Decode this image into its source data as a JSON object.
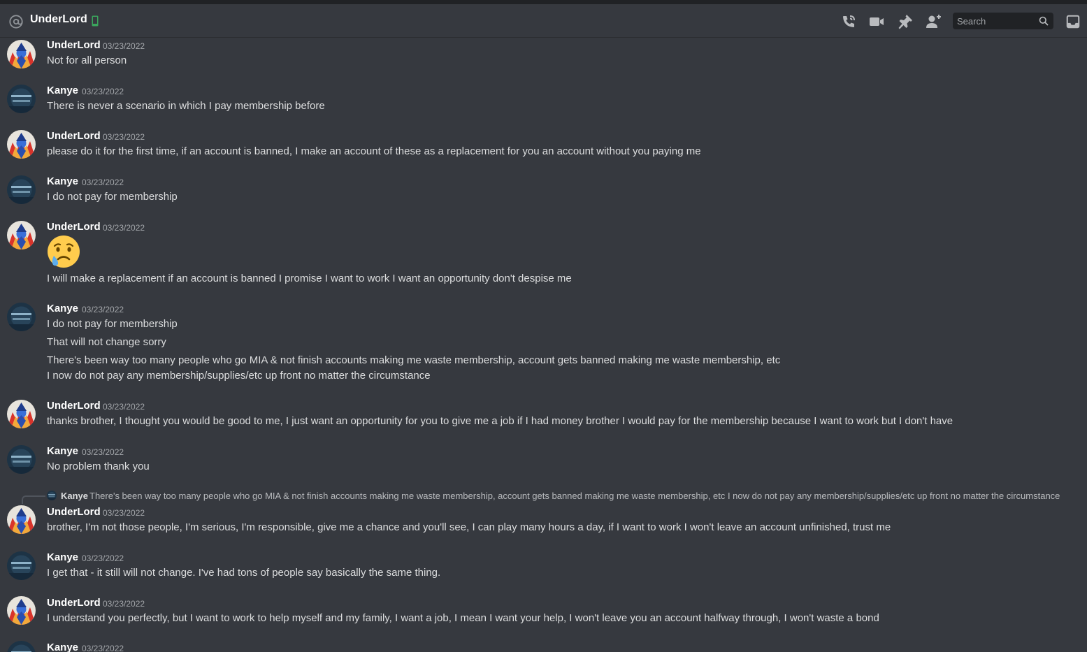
{
  "header": {
    "channel_name": "UnderLord",
    "search_placeholder": "Search"
  },
  "icons": {
    "at": "at-sign-icon",
    "mobile": "mobile-phone-icon",
    "call": "phone-call-icon",
    "video": "video-camera-icon",
    "pin": "pin-icon",
    "add_friend": "add-friend-icon",
    "search": "search-icon",
    "inbox": "inbox-icon"
  },
  "colors": {
    "background": "#36393f",
    "header_text": "#ffffff",
    "mobile_status": "#3ba55c",
    "search_bg": "#202225"
  },
  "messages": [
    {
      "author": "UnderLord",
      "timestamp": "03/23/2022",
      "lines": [
        "Not for all person"
      ]
    },
    {
      "author": "Kanye",
      "timestamp": "03/23/2022",
      "lines": [
        "There is never a scenario in which I pay membership before"
      ]
    },
    {
      "author": "UnderLord",
      "timestamp": "03/23/2022",
      "lines": [
        "please do it for the first time, if an account is banned, I make an account of these as a replacement for you an account without you paying me"
      ]
    },
    {
      "author": "Kanye",
      "timestamp": "03/23/2022",
      "lines": [
        "I do not pay for membership"
      ]
    },
    {
      "author": "UnderLord",
      "timestamp": "03/23/2022",
      "emoji": "crying-face-emoji",
      "lines": [
        "I will make a replacement if an account is banned I promise I want to work I want an opportunity don't despise me"
      ]
    },
    {
      "author": "Kanye",
      "timestamp": "03/23/2022",
      "lines": [
        "I do not pay for membership",
        "That will not change sorry",
        "There's been way too many people who go MIA & not finish accounts making me waste membership, account gets banned making me waste membership, etc",
        "I now do not pay any membership/supplies/etc up front no matter the circumstance"
      ]
    },
    {
      "author": "UnderLord",
      "timestamp": "03/23/2022",
      "lines": [
        "thanks brother, I thought you would be good to me, I just want an opportunity for you to give me a job if I had money brother I would pay for the membership because I want to work but I don't have"
      ]
    },
    {
      "author": "Kanye",
      "timestamp": "03/23/2022",
      "lines": [
        "No problem thank you"
      ]
    },
    {
      "author": "UnderLord",
      "timestamp": "03/23/2022",
      "reply": {
        "author": "Kanye",
        "text": "There's been way too many people who go MIA & not finish accounts making me waste membership, account gets banned making me waste membership, etc I now do not pay any membership/supplies/etc up front no matter the circumstance"
      },
      "lines": [
        "brother, I'm not those people, I'm serious, I'm responsible, give me a chance and you'll see, I can play many hours a day, if I want to work I won't leave an account unfinished, trust me"
      ]
    },
    {
      "author": "Kanye",
      "timestamp": "03/23/2022",
      "lines": [
        "I get that - it still will not change. I've had tons of people say basically the same thing."
      ]
    },
    {
      "author": "UnderLord",
      "timestamp": "03/23/2022",
      "lines": [
        "I understand you perfectly, but I want to work to help myself and my family, I want a job, I mean I want your help, I won't leave you an account halfway through, I won't waste a bond"
      ]
    },
    {
      "author": "Kanye",
      "timestamp": "03/23/2022",
      "lines": []
    }
  ]
}
